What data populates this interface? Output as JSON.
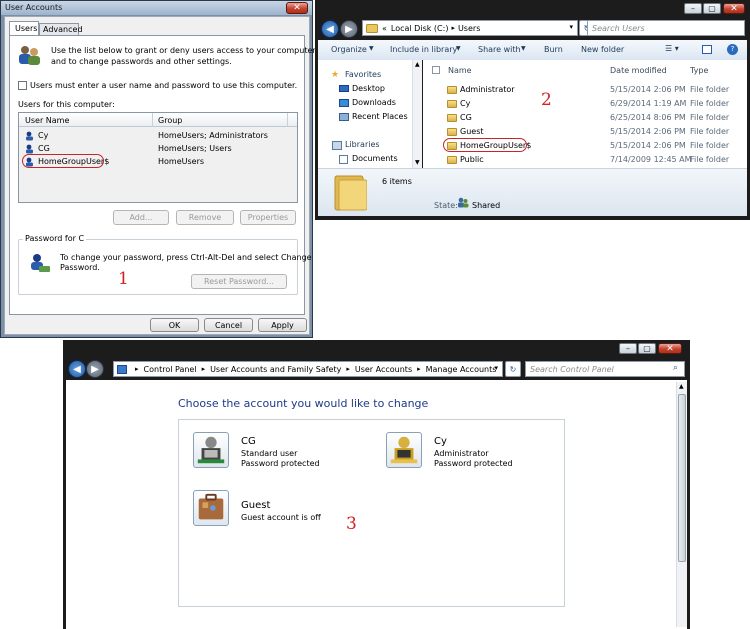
{
  "ua": {
    "title": "User Accounts",
    "tabs": [
      "Users",
      "Advanced"
    ],
    "description": [
      "Use the list below to grant or deny users access to your computer,",
      "and to change passwords and other settings."
    ],
    "checkbox_label": "Users must enter a user name and password to use this computer.",
    "users_label": "Users for this computer:",
    "columns": [
      "User Name",
      "Group"
    ],
    "rows": [
      {
        "name": "Cy",
        "group": "HomeUsers; Administrators"
      },
      {
        "name": "CG",
        "group": "HomeUsers; Users"
      },
      {
        "name": "HomeGroupUser$",
        "group": "HomeUsers"
      }
    ],
    "buttons": {
      "add": "Add...",
      "remove": "Remove",
      "properties": "Properties"
    },
    "password_group": "Password for C",
    "password_text": [
      "To change your password, press Ctrl-Alt-Del and select Change",
      "Password."
    ],
    "reset_password": "Reset Password...",
    "ok": "OK",
    "cancel": "Cancel",
    "apply": "Apply",
    "marker": "1"
  },
  "explorer": {
    "address": [
      "«",
      "Local Disk (C:)",
      "Users"
    ],
    "search_placeholder": "Search Users",
    "toolbar": [
      "Organize",
      "Include in library",
      "Share with",
      "Burn",
      "New folder"
    ],
    "nav": {
      "favorites": "Favorites",
      "favorite_items": [
        "Desktop",
        "Downloads",
        "Recent Places"
      ],
      "libraries": "Libraries",
      "library_items": [
        "Documents"
      ]
    },
    "columns": [
      "Name",
      "Date modified",
      "Type"
    ],
    "rows": [
      {
        "name": "Administrator",
        "date": "5/15/2014 2:06 PM",
        "type": "File folder"
      },
      {
        "name": "Cy",
        "date": "6/29/2014 1:19 AM",
        "type": "File folder"
      },
      {
        "name": "CG",
        "date": "6/25/2014 8:06 PM",
        "type": "File folder"
      },
      {
        "name": "Guest",
        "date": "5/15/2014 2:06 PM",
        "type": "File folder"
      },
      {
        "name": "HomeGroupUser$",
        "date": "5/15/2014 2:06 PM",
        "type": "File folder"
      },
      {
        "name": "Public",
        "date": "7/14/2009 12:45 AM",
        "type": "File folder"
      }
    ],
    "item_count": "6 items",
    "state_label": "State:",
    "state_value": "Shared",
    "marker": "2"
  },
  "cp": {
    "breadcrumb": [
      "Control Panel",
      "User Accounts and Family Safety",
      "User Accounts",
      "Manage Accounts"
    ],
    "search_placeholder": "Search Control Panel",
    "heading": "Choose the account you would like to change",
    "accounts": [
      {
        "name": "CG",
        "line1": "Standard user",
        "line2": "Password protected"
      },
      {
        "name": "Cy",
        "line1": "Administrator",
        "line2": "Password protected"
      },
      {
        "name": "Guest",
        "line1": "Guest account is off",
        "line2": ""
      }
    ],
    "marker": "3"
  },
  "colors": {
    "accent": "#1e5a9a",
    "highlight_ring": "#c8242a",
    "chrome": "#1c1c1c"
  }
}
